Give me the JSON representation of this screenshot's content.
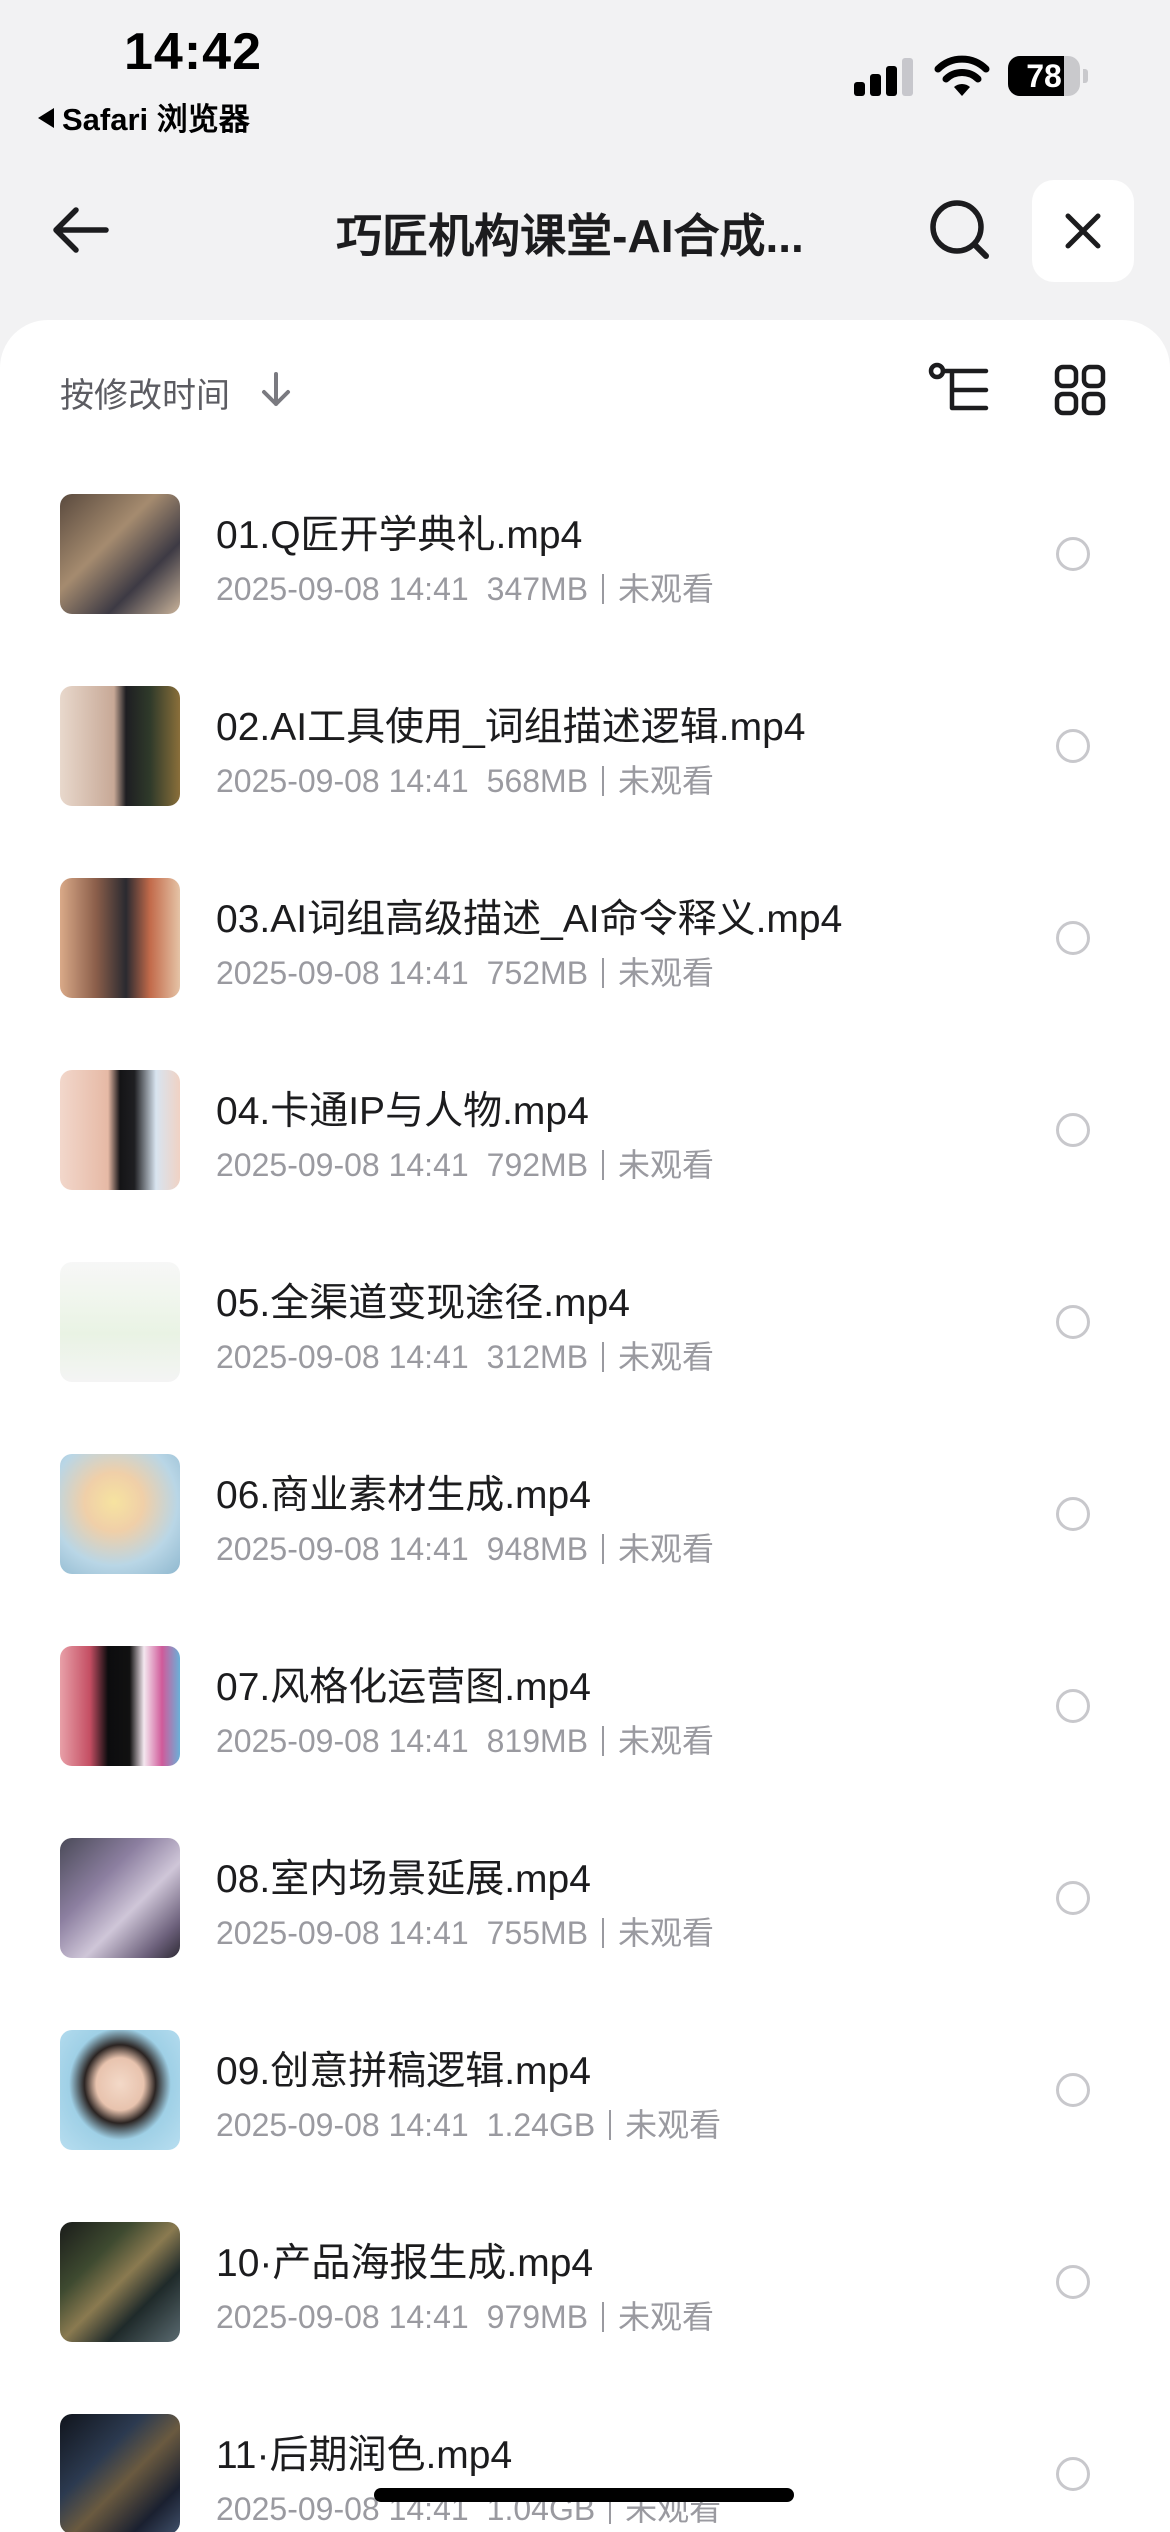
{
  "status_bar": {
    "time": "14:42",
    "back_app": "Safari 浏览器",
    "battery": "78",
    "battery_level": 0.78,
    "signal_bars": 3,
    "signal_icon": "cellular-signal-icon",
    "wifi_icon": "wifi-icon"
  },
  "header": {
    "title": "巧匠机构课堂-AI合成...",
    "back_icon": "arrow-left-icon",
    "search_icon": "search-icon",
    "close_icon": "close-icon"
  },
  "toolbar": {
    "sort_label": "按修改时间",
    "sort_icon": "arrow-down-icon",
    "tree_icon": "tree-view-icon",
    "grid_icon": "grid-view-icon"
  },
  "files": [
    {
      "name": "01.Q匠开学典礼.mp4",
      "date": "2025-09-08 14:41",
      "size": "347MB",
      "status": "未观看"
    },
    {
      "name": "02.AI工具使用_词组描述逻辑.mp4",
      "date": "2025-09-08 14:41",
      "size": "568MB",
      "status": "未观看"
    },
    {
      "name": "03.AI词组高级描述_AI命令释义.mp4",
      "date": "2025-09-08 14:41",
      "size": "752MB",
      "status": "未观看"
    },
    {
      "name": "04.卡通IP与人物.mp4",
      "date": "2025-09-08 14:41",
      "size": "792MB",
      "status": "未观看"
    },
    {
      "name": "05.全渠道变现途径.mp4",
      "date": "2025-09-08 14:41",
      "size": "312MB",
      "status": "未观看"
    },
    {
      "name": "06.商业素材生成.mp4",
      "date": "2025-09-08 14:41",
      "size": "948MB",
      "status": "未观看"
    },
    {
      "name": "07.风格化运营图.mp4",
      "date": "2025-09-08 14:41",
      "size": "819MB",
      "status": "未观看"
    },
    {
      "name": "08.室内场景延展.mp4",
      "date": "2025-09-08 14:41",
      "size": "755MB",
      "status": "未观看"
    },
    {
      "name": "09.创意拼稿逻辑.mp4",
      "date": "2025-09-08 14:41",
      "size": "1.24GB",
      "status": "未观看"
    },
    {
      "name": "10·产品海报生成.mp4",
      "date": "2025-09-08 14:41",
      "size": "979MB",
      "status": "未观看"
    },
    {
      "name": "11·后期润色.mp4",
      "date": "2025-09-08 14:41",
      "size": "1.04GB",
      "status": "未观看"
    }
  ],
  "colors": {
    "page_bg": "#f2f2f3",
    "sheet_bg": "#ffffff",
    "primary_text": "#1c1c1e",
    "secondary_text": "#9a9aa0",
    "radio_border": "#c8c8cc"
  }
}
